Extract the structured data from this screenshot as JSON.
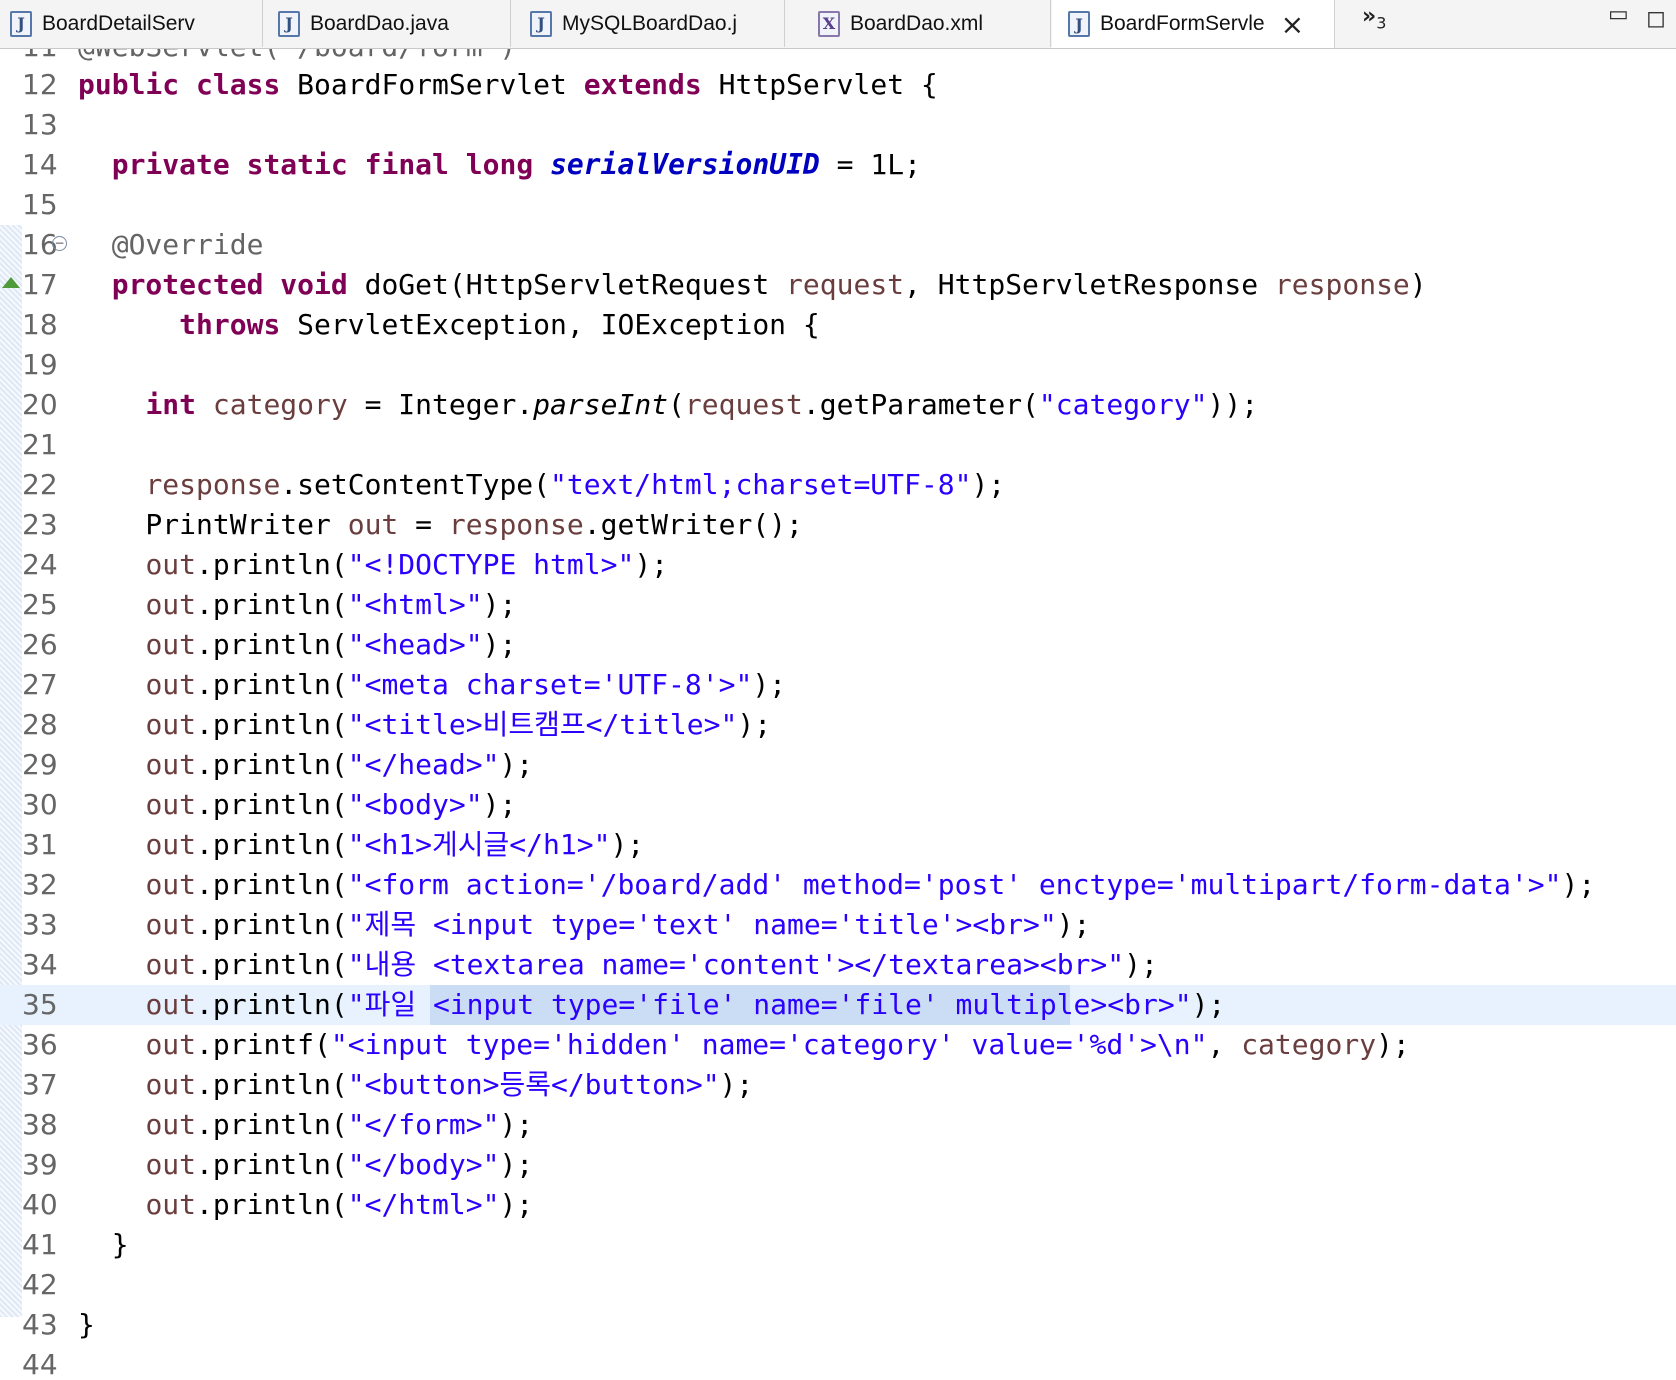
{
  "tabs": [
    {
      "label": "BoardDetailServ",
      "icon": "java-file-icon"
    },
    {
      "label": "BoardDao.java",
      "icon": "java-file-icon"
    },
    {
      "label": "MySQLBoardDao.j",
      "icon": "java-file-icon"
    },
    {
      "label": "BoardDao.xml",
      "icon": "xml-file-icon"
    },
    {
      "label": "BoardFormServle",
      "icon": "java-file-icon",
      "active": true
    }
  ],
  "overflow": {
    "glyph": "»",
    "count": "3"
  },
  "editor": {
    "partial_top_line": "@WebServlet(\"/board/form\")",
    "highlighted_line": 35,
    "lines": [
      {
        "n": "12",
        "text": "public class BoardFormServlet extends HttpServlet {"
      },
      {
        "n": "13",
        "text": ""
      },
      {
        "n": "14",
        "text": "  private static final long serialVersionUID = 1L;"
      },
      {
        "n": "15",
        "text": ""
      },
      {
        "n": "16",
        "text": "  @Override"
      },
      {
        "n": "17",
        "text": "  protected void doGet(HttpServletRequest request, HttpServletResponse response)"
      },
      {
        "n": "18",
        "text": "      throws ServletException, IOException {"
      },
      {
        "n": "19",
        "text": ""
      },
      {
        "n": "20",
        "text": "    int category = Integer.parseInt(request.getParameter(\"category\"));"
      },
      {
        "n": "21",
        "text": ""
      },
      {
        "n": "22",
        "text": "    response.setContentType(\"text/html;charset=UTF-8\");"
      },
      {
        "n": "23",
        "text": "    PrintWriter out = response.getWriter();"
      },
      {
        "n": "24",
        "text": "    out.println(\"<!DOCTYPE html>\");"
      },
      {
        "n": "25",
        "text": "    out.println(\"<html>\");"
      },
      {
        "n": "26",
        "text": "    out.println(\"<head>\");"
      },
      {
        "n": "27",
        "text": "    out.println(\"<meta charset='UTF-8'>\");"
      },
      {
        "n": "28",
        "text": "    out.println(\"<title>비트캠프</title>\");"
      },
      {
        "n": "29",
        "text": "    out.println(\"</head>\");"
      },
      {
        "n": "30",
        "text": "    out.println(\"<body>\");"
      },
      {
        "n": "31",
        "text": "    out.println(\"<h1>게시글</h1>\");"
      },
      {
        "n": "32",
        "text": "    out.println(\"<form action='/board/add' method='post' enctype='multipart/form-data'>\");"
      },
      {
        "n": "33",
        "text": "    out.println(\"제목 <input type='text' name='title'><br>\");"
      },
      {
        "n": "34",
        "text": "    out.println(\"내용 <textarea name='content'></textarea><br>\");"
      },
      {
        "n": "35",
        "text": "    out.println(\"파일 <input type='file' name='file' multiple><br>\");"
      },
      {
        "n": "36",
        "text": "    out.printf(\"<input type='hidden' name='category' value='%d'>\\n\", category);"
      },
      {
        "n": "37",
        "text": "    out.println(\"<button>등록</button>\");"
      },
      {
        "n": "38",
        "text": "    out.println(\"</form>\");"
      },
      {
        "n": "39",
        "text": "    out.println(\"</body>\");"
      },
      {
        "n": "40",
        "text": "    out.println(\"</html>\");"
      },
      {
        "n": "41",
        "text": "  }"
      },
      {
        "n": "42",
        "text": ""
      },
      {
        "n": "43",
        "text": "}"
      },
      {
        "n": "44",
        "text": ""
      }
    ]
  }
}
